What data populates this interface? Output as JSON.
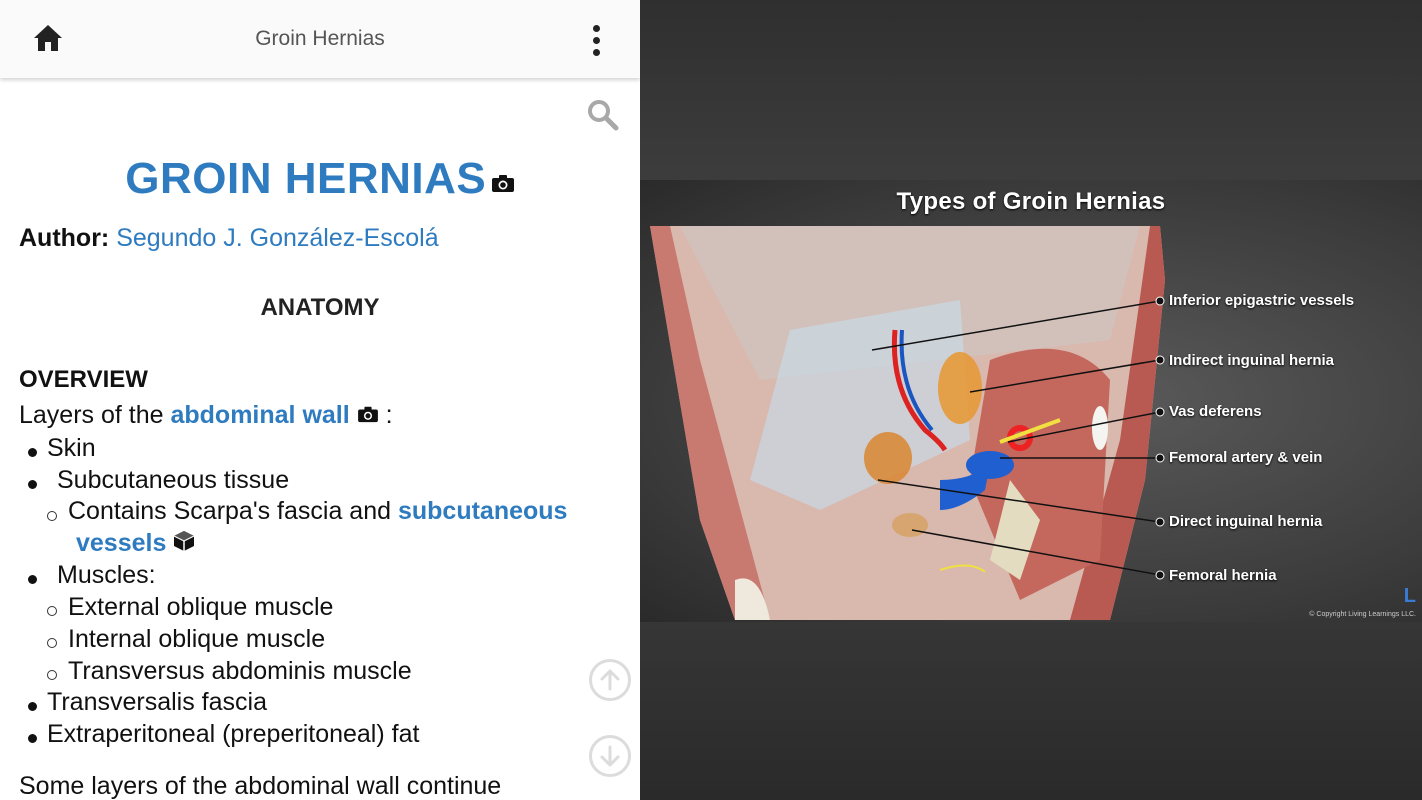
{
  "topbar": {
    "title": "Groin Hernias",
    "home_icon": "home-icon",
    "menu_icon": "more-vert-icon"
  },
  "search": {
    "icon": "search-icon"
  },
  "article": {
    "title": "GROIN HERNIAS",
    "author_label": "Author:",
    "author_name": "Segundo J. González-Escolá",
    "section": "ANATOMY",
    "overview": "OVERVIEW",
    "layers_prefix": "Layers of the ",
    "layers_link": "abdominal wall",
    "layers_suffix": " :",
    "items": [
      {
        "text": "Skin"
      },
      {
        "text": "Subcutaneous tissue"
      },
      {
        "text_prefix": "Contains Scarpa's fascia and ",
        "link": "subcutaneous",
        "link2": "vessels"
      },
      {
        "text": "Muscles:"
      },
      {
        "text": "External oblique muscle"
      },
      {
        "text": "Internal oblique muscle"
      },
      {
        "text": "Transversus abdominis muscle"
      },
      {
        "text": "Transversalis fascia"
      },
      {
        "text": "Extraperitoneal (preperitoneal) fat"
      }
    ],
    "tail": "Some layers of the abdominal wall continue"
  },
  "scroll": {
    "up_icon": "arrow-up-circle-icon",
    "down_icon": "arrow-down-circle-icon"
  },
  "figure": {
    "title": "Types of Groin Hernias",
    "labels": [
      "Inferior epigastric vessels",
      "Indirect inguinal hernia",
      "Vas deferens",
      "Femoral artery & vein",
      "Direct inguinal hernia",
      "Femoral hernia"
    ],
    "copyright": "© Copyright Living Learnings LLC.",
    "logo": "L"
  },
  "colors": {
    "link": "#2e7bc0",
    "topbar": "#fafafa",
    "viewer_bg": "#3a3a3a"
  }
}
